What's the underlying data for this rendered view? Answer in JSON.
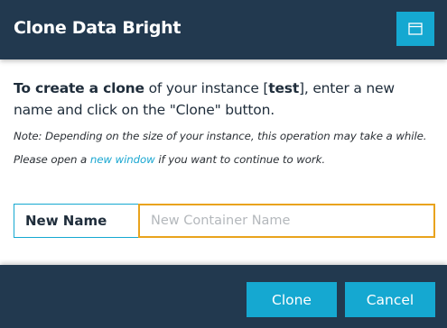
{
  "dialog": {
    "title": "Clone Data Bright",
    "window_button_icon": "window-icon"
  },
  "intro": {
    "bold_lead": "To create a clone",
    "part1": " of your instance [",
    "instance_name": "test",
    "part2": "], enter a new name and click on the \"Clone\" button."
  },
  "note": {
    "part1": "Note: Depending on the size of your instance, this operation may take a while. Please open a ",
    "link_text": "new window",
    "part2": " if you want to continue to work."
  },
  "form": {
    "label": "New Name",
    "value": "",
    "placeholder": "New Container Name"
  },
  "footer": {
    "clone_label": "Clone",
    "cancel_label": "Cancel"
  },
  "colors": {
    "header_bg": "#22394f",
    "accent": "#15a8d1",
    "focus_border": "#e9a31d"
  }
}
